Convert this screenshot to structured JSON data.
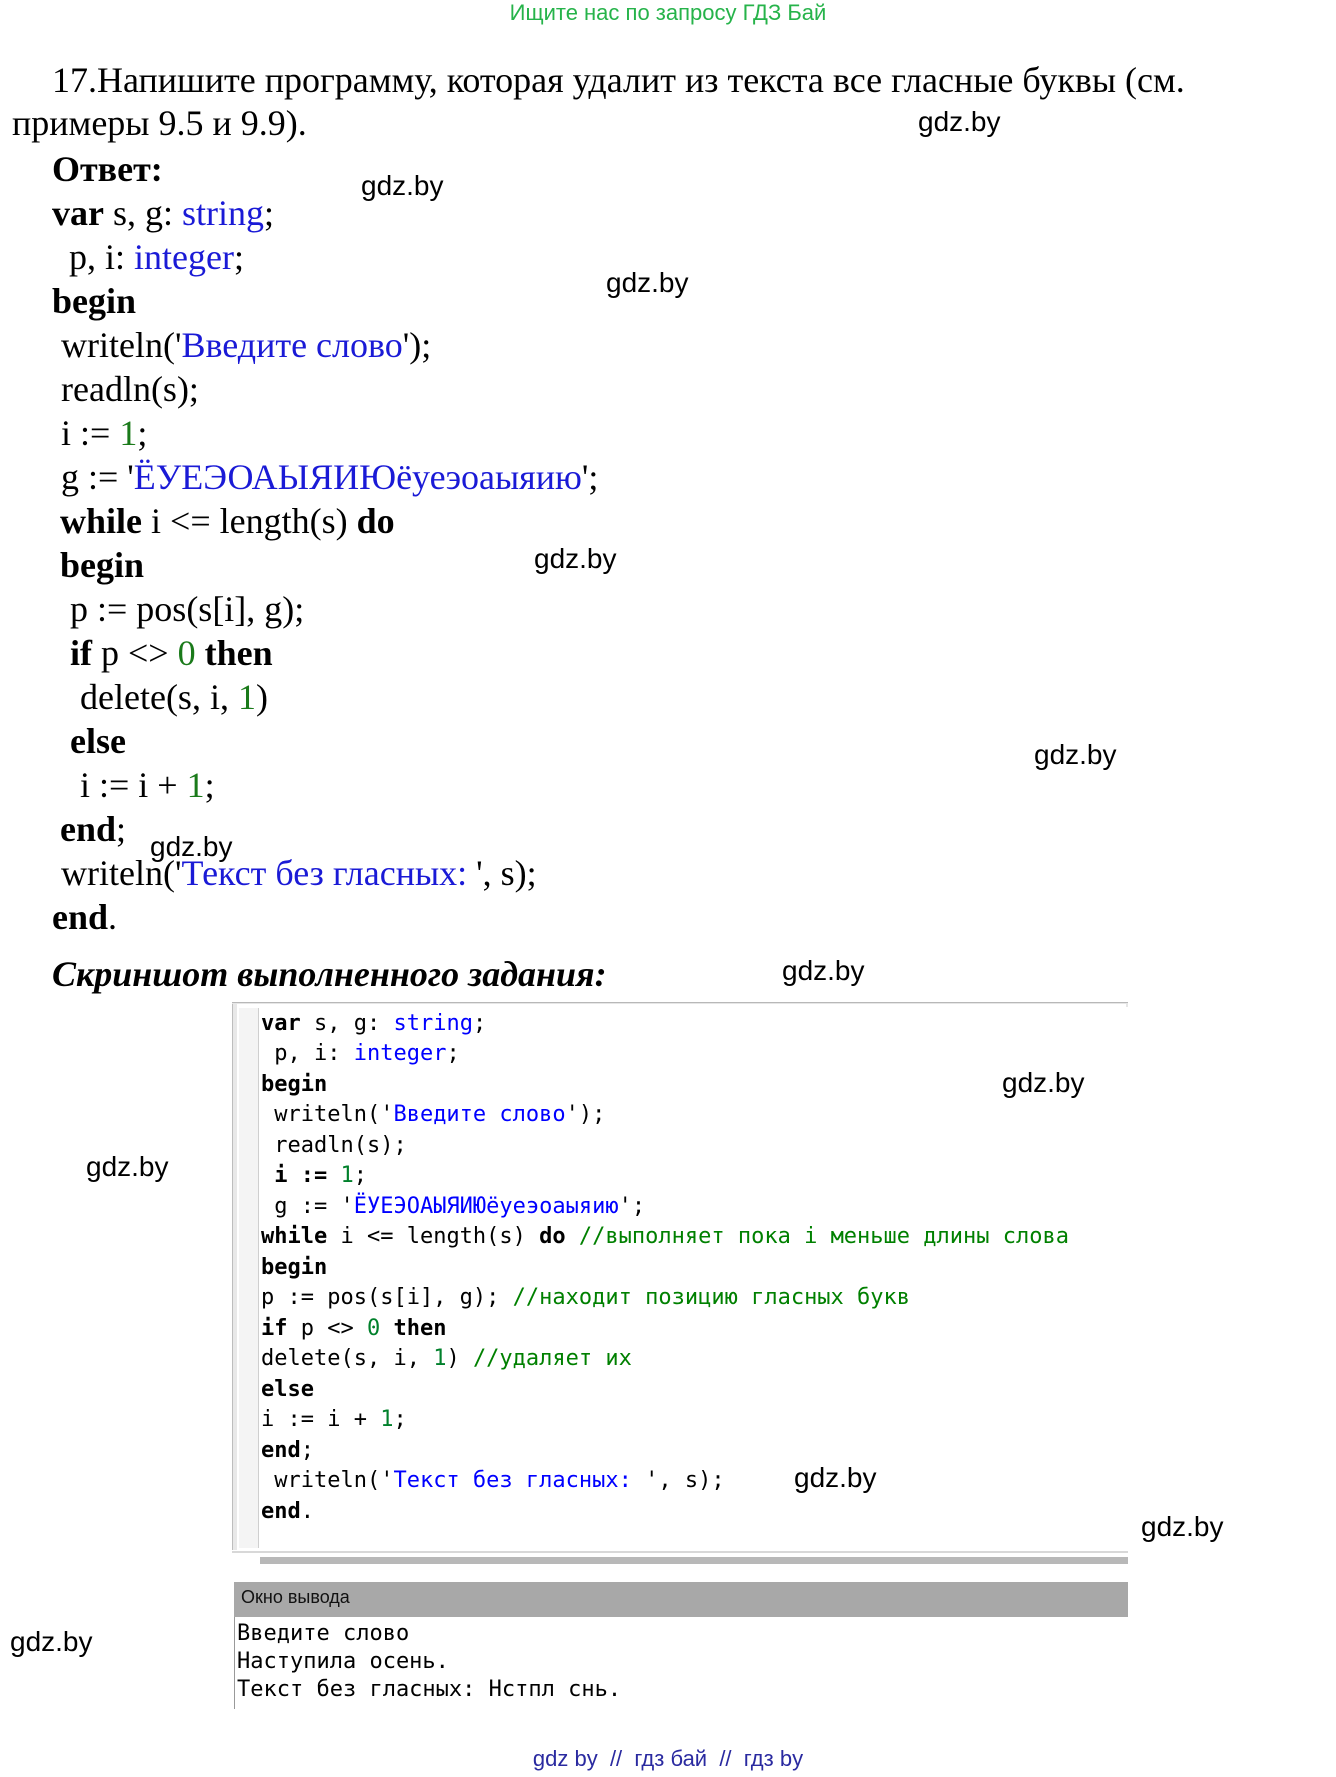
{
  "header_banner": "Ищите нас по запросу ГДЗ Бай",
  "task": {
    "line1": "17.Напишите программу, которая удалит из текста все гласные буквы (см.",
    "line2": "примеры 9.5 и 9.9)."
  },
  "answer_label": "Ответ:",
  "watermark": "gdz.by",
  "code": {
    "var_kw": "var",
    "var_names": " s, g: ",
    "string_type": "string",
    "semi": ";",
    "p_i": " p, i: ",
    "integer_type": "integer",
    "begin": "begin",
    "writeln_open": " writeln('",
    "prompt_str": "Введите слово",
    "writeln_close": "');",
    "readln": " readln(s);",
    "i_assign": " i := ",
    "one": "1",
    "g_assign": " g := '",
    "vowels_str": "ЁУЕЭОАЫЯИЮёуеэоаыяию",
    "str_close": "';",
    "while_kw": "while",
    "while_cond": " i <= length(s) ",
    "do_kw": "do",
    "p_pos": "p := pos(s[i], g);",
    "if_kw": "if",
    "if_cond": " p <> ",
    "zero": "0",
    "then_kw": "then",
    "delete_open": "delete(s, i, ",
    "delete_close": ")",
    "else_kw": "else",
    "i_inc": "i := i + ",
    "end_kw": "end",
    "result_open": " writeln('",
    "result_str": "Текст без гласных: ",
    "result_close": "', s);",
    "dot": "."
  },
  "screenshot_heading": "Скриншот выполненного задания:",
  "ide": {
    "comment_while": "//выполняет пока i меньше длины слова",
    "comment_pos": "//находит позицию гласных букв",
    "comment_delete": "//удаляет их",
    "output_title": "Окно вывода",
    "output_lines": [
      "Введите слово",
      "Наступила осень.",
      "Текст без гласных: Нстпл снь."
    ]
  },
  "footer": "gdz by  //  гдз бай  //  гдз by"
}
